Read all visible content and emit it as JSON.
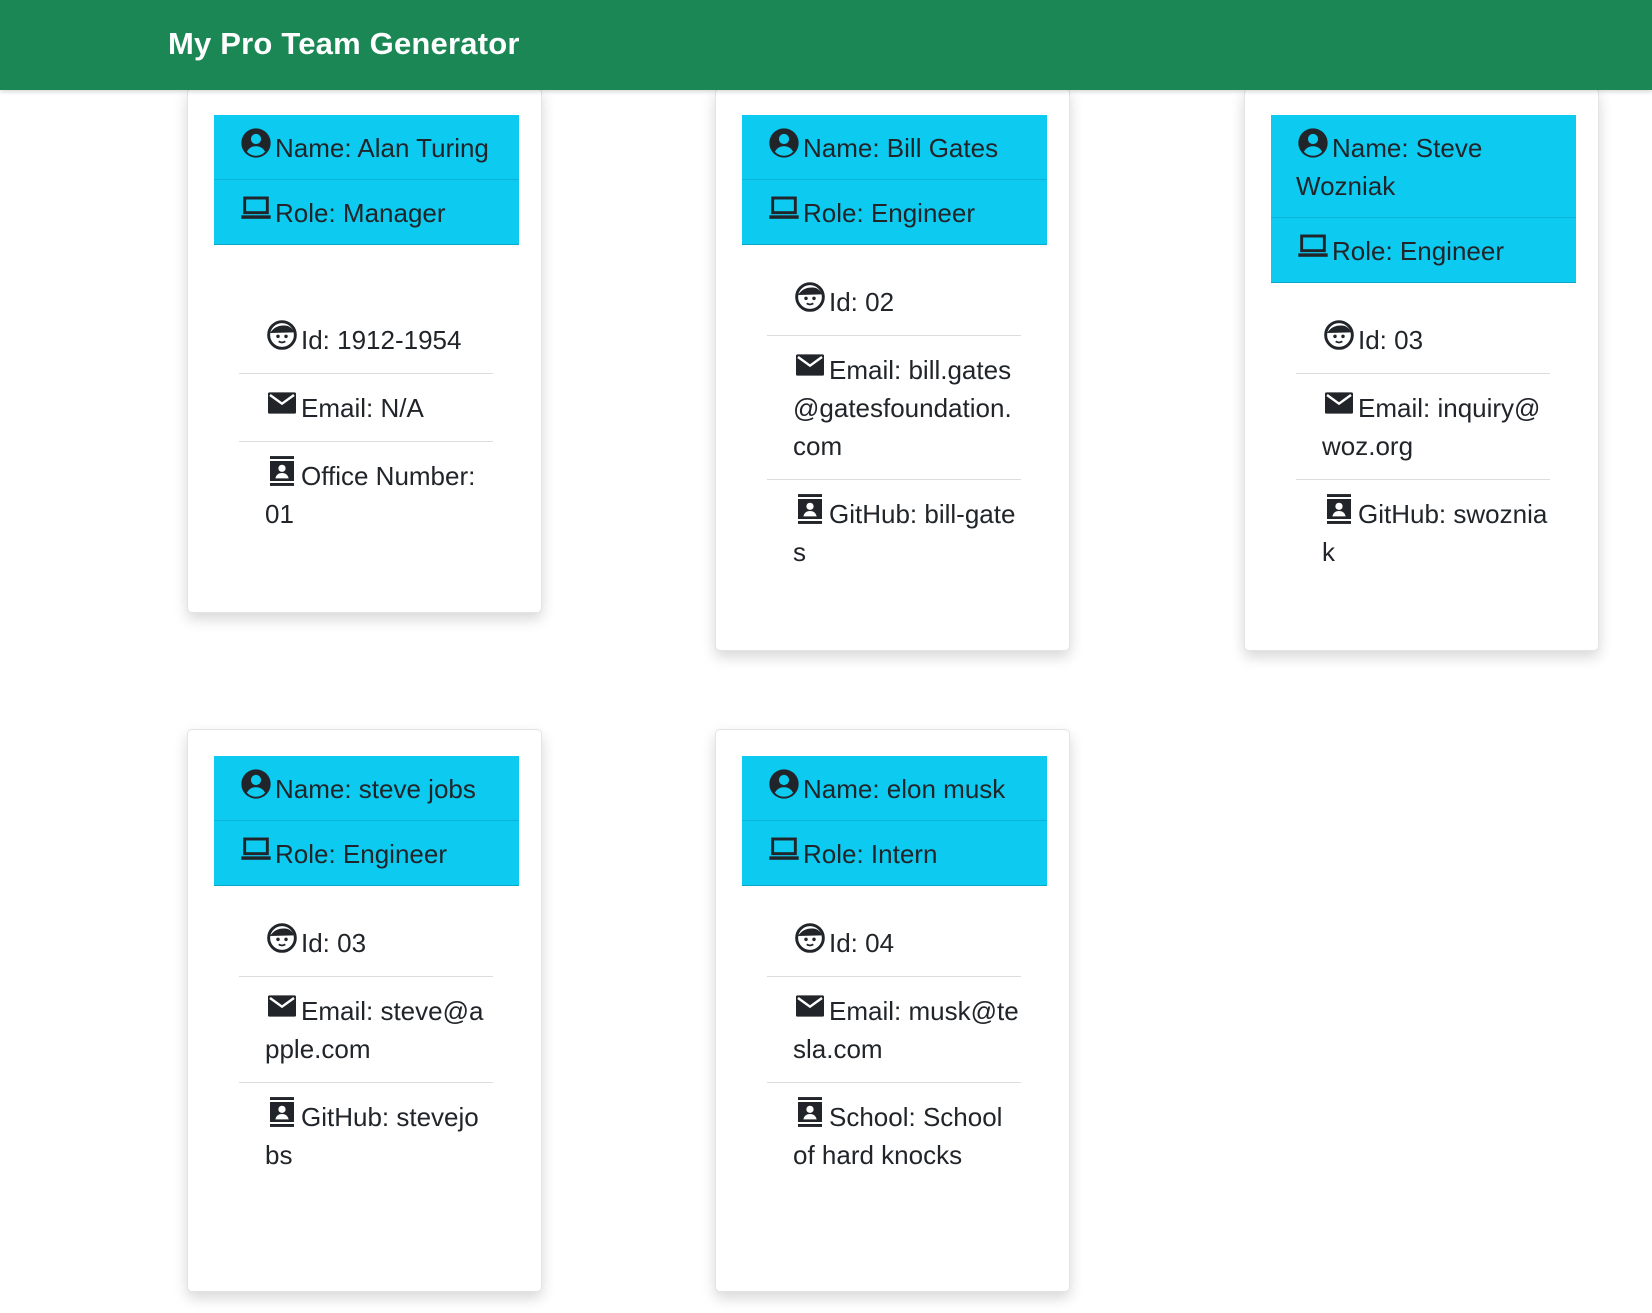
{
  "app": {
    "title": "My Pro Team Generator"
  },
  "employees": [
    {
      "name": "Name: Alan Turing",
      "role": "Role: Manager",
      "id": "Id: 1912-1954",
      "email": "Email: N/A",
      "extra": "Office Number: 01"
    },
    {
      "name": "Name: Bill Gates",
      "role": "Role: Engineer",
      "id": "Id: 02",
      "email": "Email: bill.gates@gatesfoundation.com",
      "extra": "GitHub: bill-gates"
    },
    {
      "name": "Name: Steve Wozniak",
      "role": "Role: Engineer",
      "id": "Id: 03",
      "email": "Email: inquiry@woz.org",
      "extra": "GitHub: swozniak"
    },
    {
      "name": "Name: steve jobs",
      "role": "Role: Engineer",
      "id": "Id: 03",
      "email": "Email: steve@apple.com",
      "extra": "GitHub: stevejobs"
    },
    {
      "name": "Name: elon musk",
      "role": "Role: Intern",
      "id": "Id: 04",
      "email": "Email: musk@tesla.com",
      "extra": "School: School of hard knocks"
    }
  ],
  "icons": {
    "name": "person-circle-icon",
    "role": "laptop-icon",
    "id": "face-icon",
    "email": "envelope-icon",
    "extra": "contact-card-icon"
  },
  "colors": {
    "navbar": "#1b8755",
    "card_header": "#0dcaf0",
    "brand_text": "#ffffff"
  }
}
